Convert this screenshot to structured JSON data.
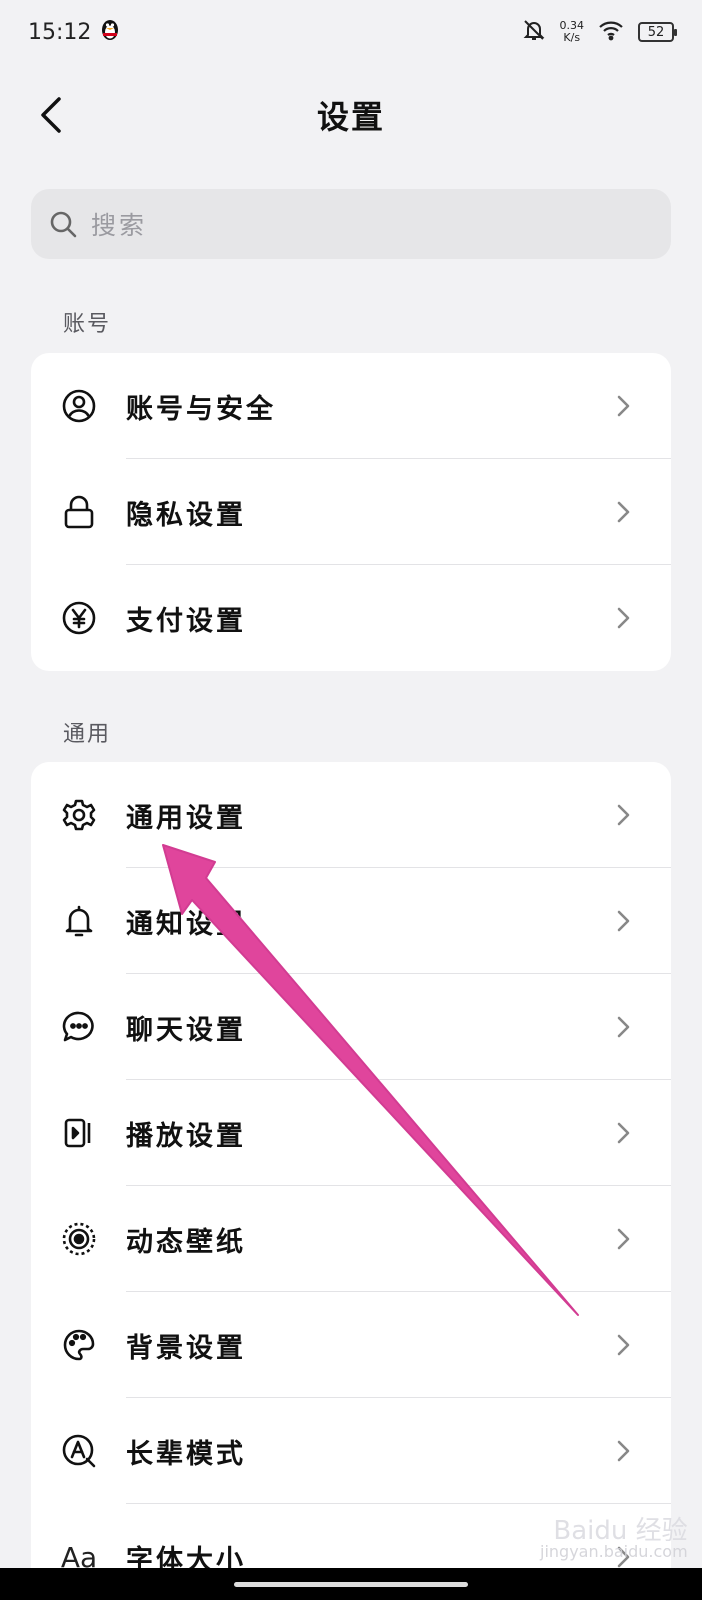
{
  "status_bar": {
    "time": "15:12",
    "speed_value": "0.34",
    "speed_unit": "K/s",
    "battery": "52"
  },
  "header": {
    "title": "设置"
  },
  "search": {
    "placeholder": "搜索"
  },
  "sections": [
    {
      "title": "账号",
      "items": [
        {
          "label": "账号与安全",
          "icon": "account-icon"
        },
        {
          "label": "隐私设置",
          "icon": "lock-icon"
        },
        {
          "label": "支付设置",
          "icon": "yen-icon"
        }
      ]
    },
    {
      "title": "通用",
      "items": [
        {
          "label": "通用设置",
          "icon": "gear-icon"
        },
        {
          "label": "通知设置",
          "icon": "bell-icon"
        },
        {
          "label": "聊天设置",
          "icon": "chat-icon"
        },
        {
          "label": "播放设置",
          "icon": "play-icon"
        },
        {
          "label": "动态壁纸",
          "icon": "wallpaper-icon"
        },
        {
          "label": "背景设置",
          "icon": "palette-icon"
        },
        {
          "label": "长辈模式",
          "icon": "elder-mode-icon"
        },
        {
          "label": "字体大小",
          "icon": "font-size-icon",
          "icon_text": "Aa"
        }
      ]
    }
  ],
  "watermark": {
    "main": "Baidu 经验",
    "sub": "jingyan.baidu.com"
  },
  "colors": {
    "background": "#f2f2f4",
    "card": "#ffffff",
    "annotation_arrow": "#e0459c"
  }
}
